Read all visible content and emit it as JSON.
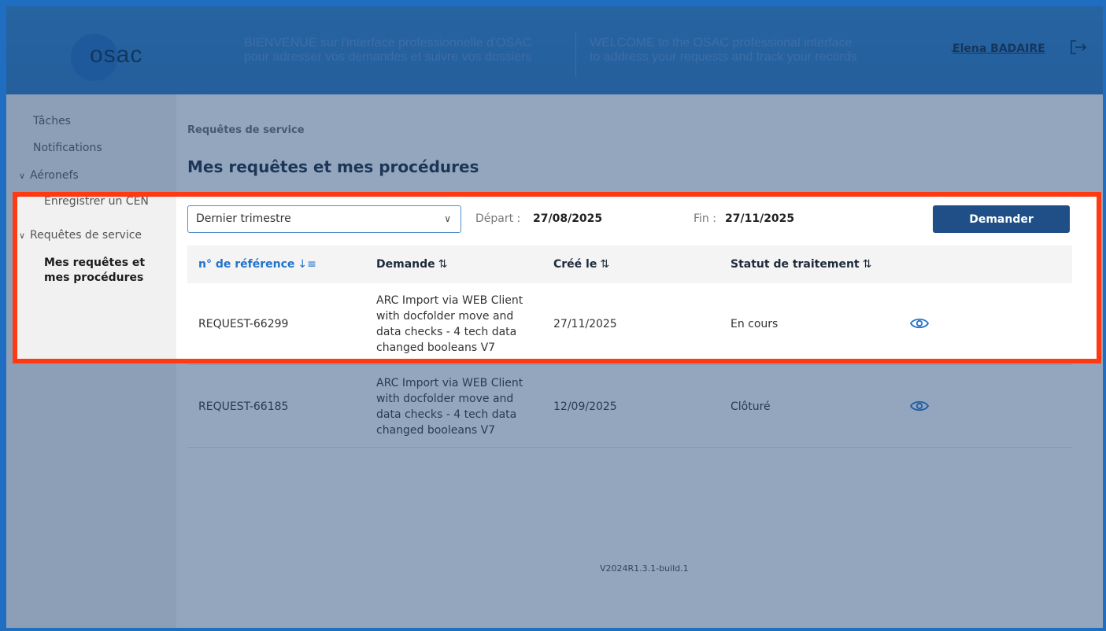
{
  "header": {
    "logo": "osac",
    "welcome_fr_line1": "BIENVENUE sur l'interface professionnelle d'OSAC",
    "welcome_fr_line2": "pour adresser vos demandes et suivre vos dossiers",
    "welcome_en_line1": "WELCOME to the OSAC professional interface",
    "welcome_en_line2": "to address your requests and track your records",
    "user_name": "Elena BADAIRE",
    "icons": {
      "user_chevron": "chevron-down-icon",
      "logout": "logout-icon"
    }
  },
  "sidebar": {
    "items": [
      {
        "label": "Tâches"
      },
      {
        "label": "Notifications"
      },
      {
        "label": "Aéronefs"
      },
      {
        "label": "Enregistrer un CEN"
      },
      {
        "label": "Requêtes de service"
      },
      {
        "label": "Mes requêtes et mes procédures"
      }
    ]
  },
  "main": {
    "breadcrumb": "Requêtes de service",
    "title": "Mes requêtes et mes procédures",
    "filters": {
      "period_value": "Dernier trimestre",
      "start_label": "Départ :",
      "start_value": "27/08/2025",
      "end_label": "Fin :",
      "end_value": "27/11/2025",
      "request_button": "Demander"
    },
    "table": {
      "columns": [
        "n° de référence",
        "Demande",
        "Créé le",
        "Statut de traitement"
      ],
      "rows": [
        {
          "ref": "REQUEST-66299",
          "request": "ARC Import via WEB Client with docfolder move and data checks - 4 tech data changed booleans V7",
          "created": "27/11/2025",
          "status": "En cours"
        },
        {
          "ref": "REQUEST-66185",
          "request": "ARC Import via WEB Client with docfolder move and data checks - 4 tech data changed booleans V7",
          "created": "12/09/2025",
          "status": "Clôturé"
        }
      ]
    },
    "version": "V2024R1.3.1-build.1"
  },
  "colors": {
    "header_bg": "#2f80c9",
    "primary_button": "#1f4f86",
    "active_sort": "#2173c9",
    "highlight_border": "#ff3a12",
    "overlay": "rgba(30,70,120,0.48)"
  }
}
